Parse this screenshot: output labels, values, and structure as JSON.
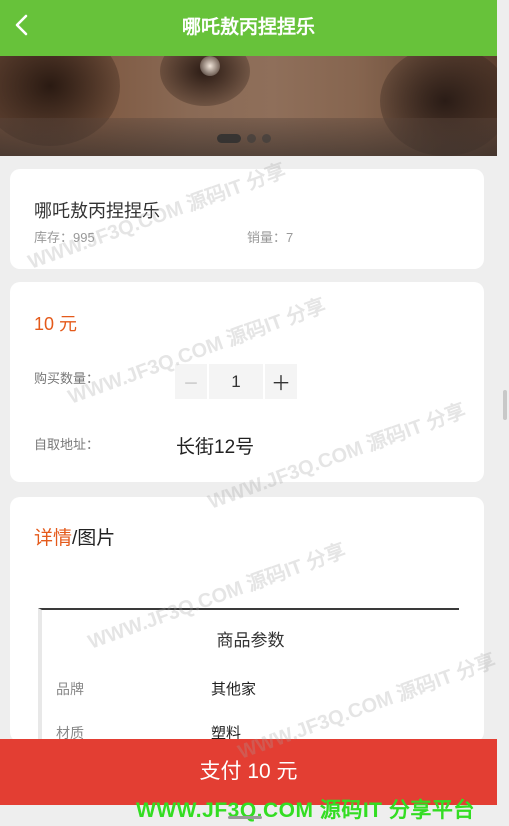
{
  "header": {
    "title": "哪吒敖丙捏捏乐"
  },
  "banner": {
    "slides": 3,
    "active_slide": 1
  },
  "product": {
    "name": "哪吒敖丙捏捏乐",
    "stock": "库存：995",
    "sales": "销量：7"
  },
  "purchase": {
    "price": "10 元",
    "quantity_label": "购买数量：",
    "minus": "－",
    "quantity": "1",
    "plus": "＋",
    "address_label": "自取地址：",
    "address": "长街12号"
  },
  "details": {
    "tab_active": "详情",
    "tab_separator": "/",
    "tab_other": "图片",
    "spec_title": "商品参数",
    "rows": [
      {
        "key": "品牌",
        "value": "其他家"
      },
      {
        "key": "材质",
        "value": "塑料"
      }
    ]
  },
  "pay_button": "支付 10 元",
  "watermark": {
    "text": "WWW.JF3Q.COM 源码IT 分享",
    "bottom": "WWW.JF3Q.COM 源码IT 分享平台"
  },
  "colors": {
    "header": "#67c23a",
    "accent": "#e45a1b",
    "pay": "#e33e33"
  }
}
